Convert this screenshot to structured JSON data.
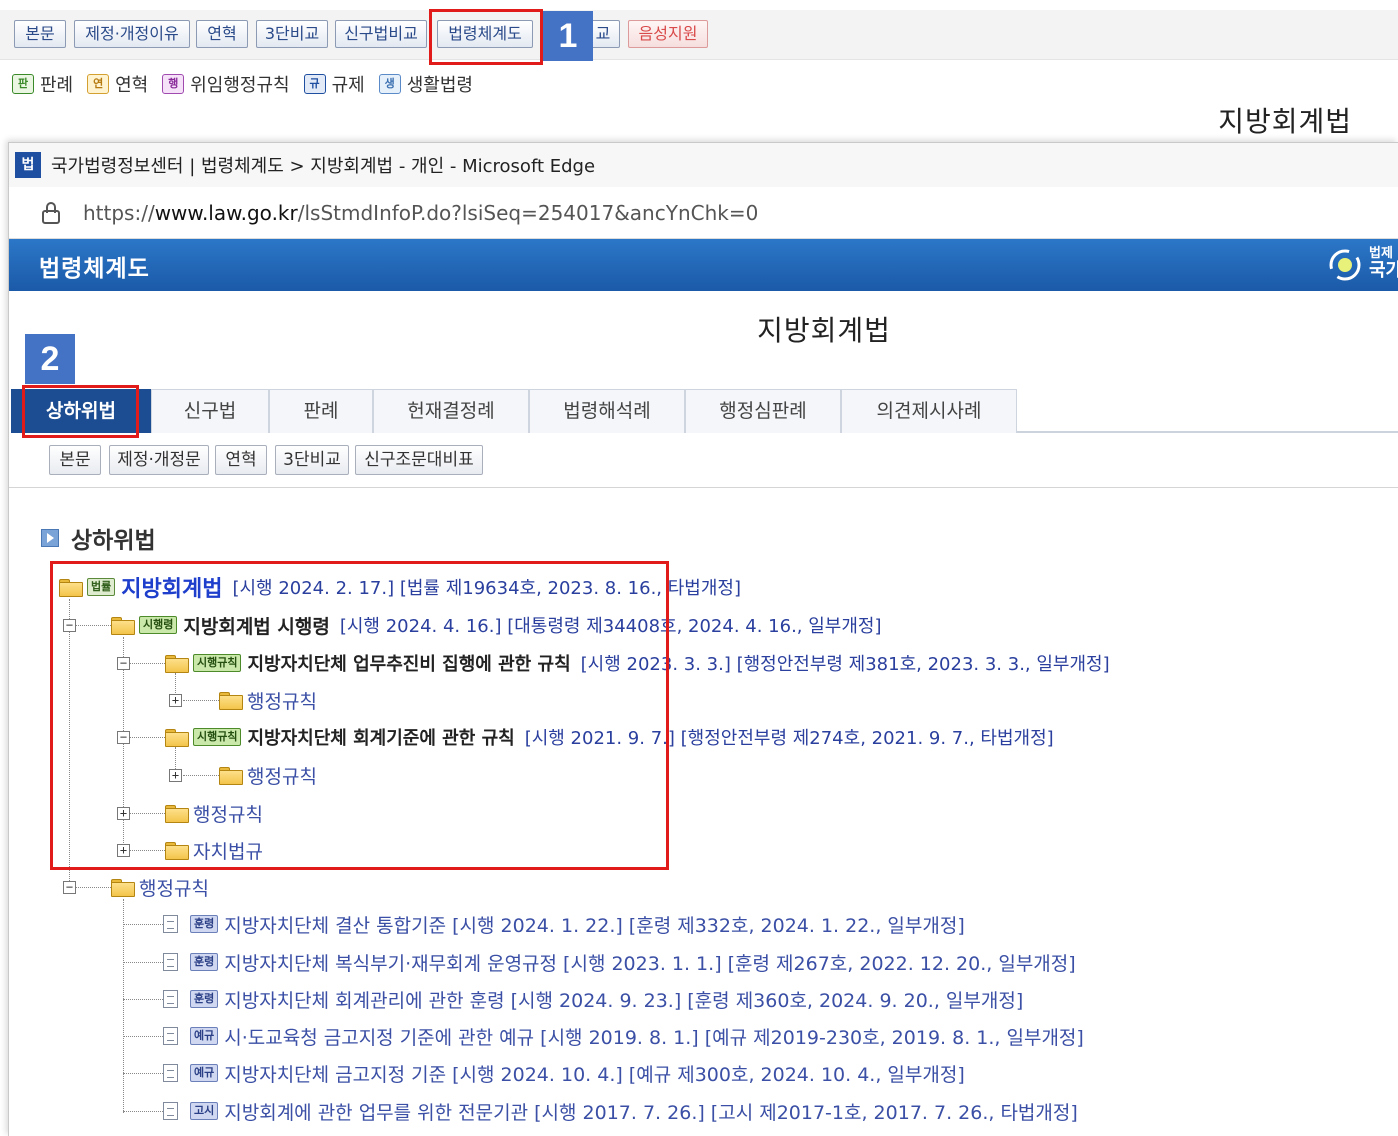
{
  "top_toolbar": {
    "buttons": [
      "본문",
      "제정·개정이유",
      "연혁",
      "3단비교",
      "신구법비교",
      "법령체계도",
      "교",
      "음성지원"
    ]
  },
  "legend": [
    {
      "badge": "판",
      "label": "판례"
    },
    {
      "badge": "연",
      "label": "연혁"
    },
    {
      "badge": "행",
      "label": "위임행정규칙"
    },
    {
      "badge": "규",
      "label": "규제"
    },
    {
      "badge": "생",
      "label": "생활법령"
    }
  ],
  "background_law_title": "지방회계법",
  "window": {
    "icon_label": "법",
    "title": "국가법령정보센터 | 법령체계도 > 지방회계법 - 개인 - Microsoft Edge",
    "url_prefix": "https://",
    "url_host": "www.law.go.kr",
    "url_path": "/lsStmdInfoP.do?lsiSeq=254017&ancYnChk=0"
  },
  "site": {
    "header_title": "법령체계도",
    "logo_line1": "법제",
    "logo_line2": "국가"
  },
  "law_title": "지방회계법",
  "tabs": [
    "상하위법",
    "신구법",
    "판례",
    "헌재결정례",
    "법령해석례",
    "행정심판례",
    "의견제시사례"
  ],
  "sub_buttons": [
    "본문",
    "제정·개정문",
    "연혁",
    "3단비교",
    "신구조문대비표"
  ],
  "section_heading": "상하위법",
  "tree": {
    "root": {
      "badge": "법률",
      "title": "지방회계법",
      "meta": "[시행 2024. 2. 17.] [법률 제19634호, 2023. 8. 16., 타법개정]"
    },
    "decree": {
      "badge": "시행령",
      "title": "지방회계법 시행령",
      "meta": "[시행 2024. 4. 16.] [대통령령 제34408호, 2024. 4. 16., 일부개정]"
    },
    "rule1": {
      "badge": "시행규칙",
      "title": "지방자치단체 업무추진비 집행에 관한 규칙",
      "meta": "[시행 2023. 3. 3.] [행정안전부령 제381호, 2023. 3. 3., 일부개정]"
    },
    "rule1_child": "행정규칙",
    "rule2": {
      "badge": "시행규칙",
      "title": "지방자치단체 회계기준에 관한 규칙",
      "meta": "[시행 2021. 9. 7.] [행정안전부령 제274호, 2021. 9. 7., 타법개정]"
    },
    "rule2_child": "행정규칙",
    "decree_admin": "행정규칙",
    "decree_local": "자치법규",
    "root_admin": "행정규칙",
    "admin_rules": [
      {
        "badge": "훈령",
        "text": "지방자치단체 결산 통합기준 [시행 2024. 1. 22.] [훈령 제332호, 2024. 1. 22., 일부개정]"
      },
      {
        "badge": "훈령",
        "text": "지방자치단체 복식부기·재무회계 운영규정 [시행 2023. 1. 1.] [훈령 제267호, 2022. 12. 20., 일부개정]"
      },
      {
        "badge": "훈령",
        "text": "지방자치단체 회계관리에 관한 훈령 [시행 2024. 9. 23.] [훈령 제360호, 2024. 9. 20., 일부개정]"
      },
      {
        "badge": "예규",
        "text": "시·도교육청 금고지정 기준에 관한 예규 [시행 2019. 8. 1.] [예규 제2019-230호, 2019. 8. 1., 일부개정]"
      },
      {
        "badge": "예규",
        "text": "지방자치단체 금고지정 기준 [시행 2024. 10. 4.] [예규 제300호, 2024. 10. 4., 일부개정]"
      },
      {
        "badge": "고시",
        "text": "지방회계에 관한 업무를 위한 전문기관 [시행 2017. 7. 26.] [고시 제2017-1호, 2017. 7. 26., 타법개정]"
      }
    ]
  },
  "markers": [
    "1",
    "2"
  ],
  "colors": {
    "annotation_red": "#e11a1a",
    "marker_blue": "#4472c4",
    "header_blue": "#1b5aa8",
    "active_tab": "#1c4d92"
  }
}
